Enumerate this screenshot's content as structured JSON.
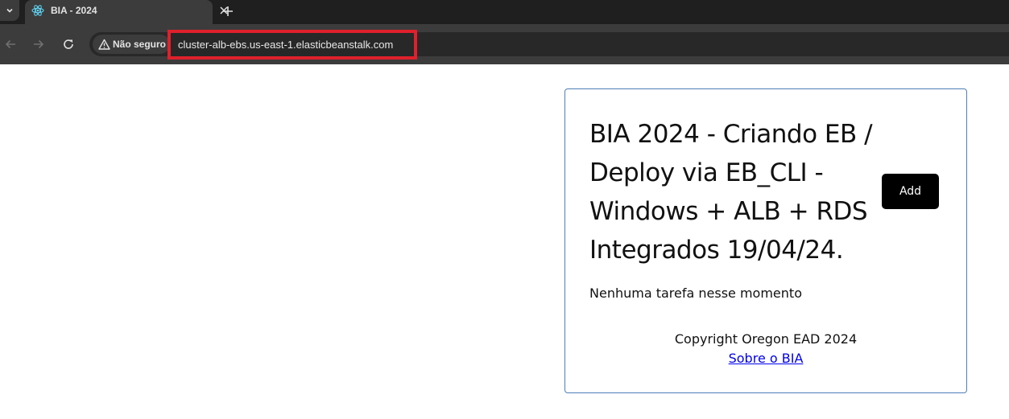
{
  "browser": {
    "tab": {
      "title": "BIA - 2024"
    },
    "address_bar": {
      "security_label": "Não seguro",
      "url": "cluster-alb-ebs.us-east-1.elasticbeanstalk.com",
      "highlight_color": "#e0202c"
    },
    "icons": {
      "tab_search": "chevron-down-icon",
      "favicon": "react-icon",
      "tab_close": "close-icon",
      "new_tab": "plus-icon",
      "back": "arrow-left-icon",
      "forward": "arrow-right-icon",
      "reload": "reload-icon",
      "security": "warning-triangle-icon"
    }
  },
  "page": {
    "title": "BIA 2024 - Criando EB / Deploy via EB_CLI - Windows + ALB + RDS Integrados 19/04/24.",
    "add_button_label": "Add",
    "empty_message": "Nenhuma tarefa nesse momento",
    "footer": {
      "copyright": "Copyright Oregon EAD 2024",
      "link_label": "Sobre o BIA"
    },
    "colors": {
      "card_border": "#4e7fb8",
      "button_bg": "#000000",
      "link": "#0000ee"
    }
  }
}
